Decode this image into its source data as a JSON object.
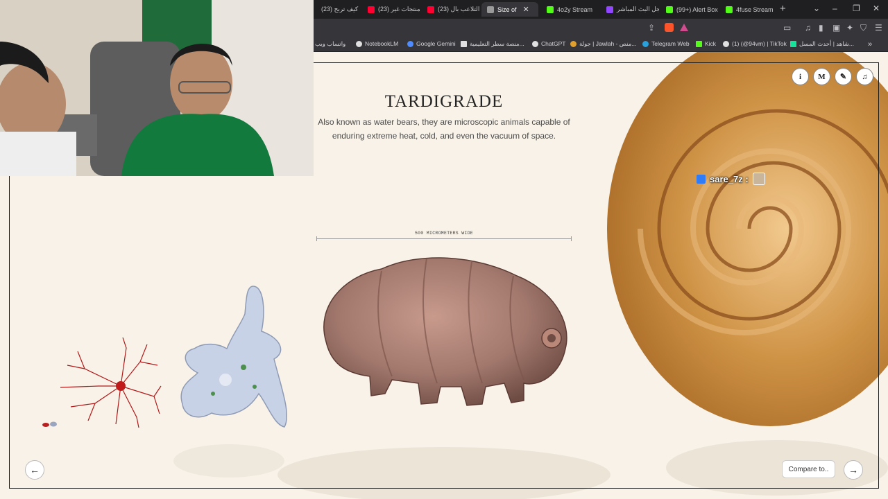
{
  "tabs": [
    {
      "title": "كيف تربح (23)",
      "color": "#ff0033"
    },
    {
      "title": "منتجات غير (23)",
      "color": "#ff0033"
    },
    {
      "title": "التلاعب بال (23)",
      "color": "#ff0033"
    },
    {
      "title": "Size of",
      "color": "#bbbbbb",
      "active": true
    },
    {
      "title": "4o2y Stream",
      "color": "#53fc18"
    },
    {
      "title": "سجل البث المباشر",
      "color": "#9146ff"
    },
    {
      "title": "(99+) Alert Box",
      "color": "#53fc18"
    },
    {
      "title": "4fuse Stream",
      "color": "#53fc18"
    }
  ],
  "bookmarks": [
    {
      "label": "واتساب ويب",
      "color": "#25d366"
    },
    {
      "label": "NotebookLM",
      "color": "#e0e0e0"
    },
    {
      "label": "Google Gemini",
      "color": "#4f8cff"
    },
    {
      "label": "منصة سطر التعليمية...",
      "color": "#e0e0e0"
    },
    {
      "label": "ChatGPT",
      "color": "#e0e0e0"
    },
    {
      "label": "جولة | Jawlah - منص...",
      "color": "#e0a030"
    },
    {
      "label": "Telegram Web",
      "color": "#2aa1da"
    },
    {
      "label": "Kick",
      "color": "#53fc18"
    },
    {
      "label": "(1)‏ (@94vm) | TikTok",
      "color": "#e0e0e0"
    },
    {
      "label": "شاهد | أحدث المسل...",
      "color": "#16e29b"
    }
  ],
  "page": {
    "title": "TARDIGRADE",
    "description": "Also known as water bears, they are microscopic animals capable of enduring extreme heat, cold, and even the vacuum of space.",
    "scale_label": "500 MICROMETERS WIDE",
    "compare_label": "Compare to..",
    "tools": [
      {
        "name": "info-button",
        "glyph": "i"
      },
      {
        "name": "medium-button",
        "glyph": "M"
      },
      {
        "name": "pencil-button",
        "glyph": "✎"
      },
      {
        "name": "music-button",
        "glyph": "♫"
      }
    ]
  },
  "overlay": {
    "chat_username": "sare_7z :"
  },
  "colors": {
    "page_bg": "#f8f2e8",
    "tardigrade": "#a2786d",
    "neuron": "#b01818",
    "amoeba": "#c8d2e6",
    "snail_shell": "#c98c3c"
  }
}
